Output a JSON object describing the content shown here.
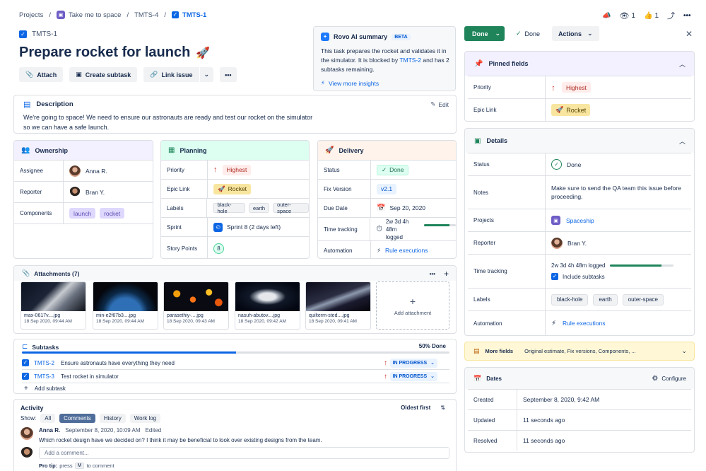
{
  "breadcrumb": {
    "projects": "Projects",
    "space": "Take me to space",
    "parent": "TMTS-4",
    "current": "TMTS-1"
  },
  "topbar": {
    "watchers": "1",
    "likes": "1"
  },
  "issue": {
    "key": "TMTS-1",
    "title": "Prepare rocket for launch",
    "title_emoji": "🚀"
  },
  "toolbar": {
    "attach": "Attach",
    "create_subtask": "Create subtask",
    "link_issue": "Link issue"
  },
  "rovo": {
    "title": "Rovo AI summary",
    "badge": "BETA",
    "text_1": "This task prepares the rocket and validates it in the simulator. It is blocked by ",
    "blocked_by": "TMTS-2",
    "text_2": " and has 2 subtasks remaining.",
    "insights": "View more insights"
  },
  "description": {
    "title": "Description",
    "edit": "Edit",
    "text": "We're going to space! We need to ensure our astronauts are ready and test our rocket on the simulator so we can have a safe launch."
  },
  "ownership": {
    "title": "Ownership",
    "assignee_label": "Assignee",
    "assignee": "Anna R.",
    "reporter_label": "Reporter",
    "reporter": "Bran Y.",
    "components_label": "Components",
    "components": [
      "launch",
      "rocket"
    ]
  },
  "planning": {
    "title": "Planning",
    "priority_label": "Priority",
    "priority": "Highest",
    "epic_label": "Epic Link",
    "epic": "Rocket",
    "labels_label": "Labels",
    "labels": [
      "black-hole",
      "earth",
      "outer-space"
    ],
    "sprint_label": "Sprint",
    "sprint": "Sprint 8 (2 days left)",
    "points_label": "Story Points",
    "points": "8"
  },
  "delivery": {
    "title": "Delivery",
    "status_label": "Status",
    "status": "Done",
    "fix_label": "Fix Version",
    "fix": "v2.1",
    "due_label": "Due Date",
    "due": "Sep 20, 2020",
    "tracking_label": "Time tracking",
    "tracking_line1": "2w 3d 4h 48m",
    "tracking_line2": "logged",
    "tracking_progress": 0.8,
    "automation_label": "Automation",
    "automation": "Rule executions"
  },
  "attachments": {
    "title": "Attachments (7)",
    "items": [
      {
        "name": "max-0617v....jpg",
        "date": "18 Sep 2020, 09:44 AM"
      },
      {
        "name": "min-e2f67b3....jpg",
        "date": "18 Sep 2020, 09:44 AM"
      },
      {
        "name": "parasethiy-....jpg",
        "date": "18 Sep 2020, 09:43 AM"
      },
      {
        "name": "nasuh-abutov....jpg",
        "date": "18 Sep 2020, 09:42 AM"
      },
      {
        "name": "quilterm-sted....jpg",
        "date": "18 Sep 2020, 09:41 AM"
      }
    ],
    "add": "Add attachment"
  },
  "subtasks": {
    "title": "Subtasks",
    "percent": "50% Done",
    "progress": 0.5,
    "items": [
      {
        "key": "TMTS-2",
        "summary": "Ensure astronauts have everything they need",
        "status": "IN PROGRESS"
      },
      {
        "key": "TMTS-3",
        "summary": "Test rocket in simulator",
        "status": "IN PROGRESS"
      }
    ],
    "add": "Add subtask"
  },
  "activity": {
    "title": "Activity",
    "show": "Show:",
    "filters": [
      "All",
      "Comments",
      "History",
      "Work log"
    ],
    "sort": "Oldest first",
    "comment": {
      "author": "Anna R.",
      "time": "September 8, 2020, 10:09 AM",
      "edited": "Edited",
      "text": "Which rocket design have we decided on? I think it may be beneficial to look over existing designs from the team."
    },
    "placeholder": "Add a comment...",
    "protip_1": "Pro tip:",
    "protip_2": "press",
    "protip_key": "M",
    "protip_3": "to comment"
  },
  "status_bar": {
    "done_button": "Done",
    "done_status": "Done",
    "actions": "Actions"
  },
  "pinned": {
    "title": "Pinned fields",
    "priority_label": "Priority",
    "priority": "Highest",
    "epic_label": "Epic Link",
    "epic": "Rocket"
  },
  "details": {
    "title": "Details",
    "status_label": "Status",
    "status": "Done",
    "notes_label": "Notes",
    "notes": "Make sure to send the QA team this issue before proceeding.",
    "projects_label": "Projects",
    "project": "Spaceship",
    "reporter_label": "Reporter",
    "reporter": "Bran Y.",
    "tracking_label": "Time tracking",
    "tracking": "2w 3d 4h 48m logged",
    "tracking_progress": 0.82,
    "include_subtasks": "Include subtasks",
    "labels_label": "Labels",
    "labels": [
      "black-hole",
      "earth",
      "outer-space"
    ],
    "automation_label": "Automation",
    "automation": "Rule executions"
  },
  "more_fields": {
    "title": "More fields",
    "summary": "Original estimate, Fix versions, Components, ..."
  },
  "dates": {
    "title": "Dates",
    "configure": "Configure",
    "created_label": "Created",
    "created": "September 8, 2020, 9:42 AM",
    "updated_label": "Updated",
    "updated": "11 seconds ago",
    "resolved_label": "Resolved",
    "resolved": "11 seconds ago"
  },
  "colors": {
    "brand": "#0c66e4",
    "done_green": "#1f845a",
    "highest_red": "#c9372c",
    "ownership_bg": "#f3f0ff",
    "planning_bg": "#dcfff1",
    "delivery_bg": "#fff3eb"
  }
}
